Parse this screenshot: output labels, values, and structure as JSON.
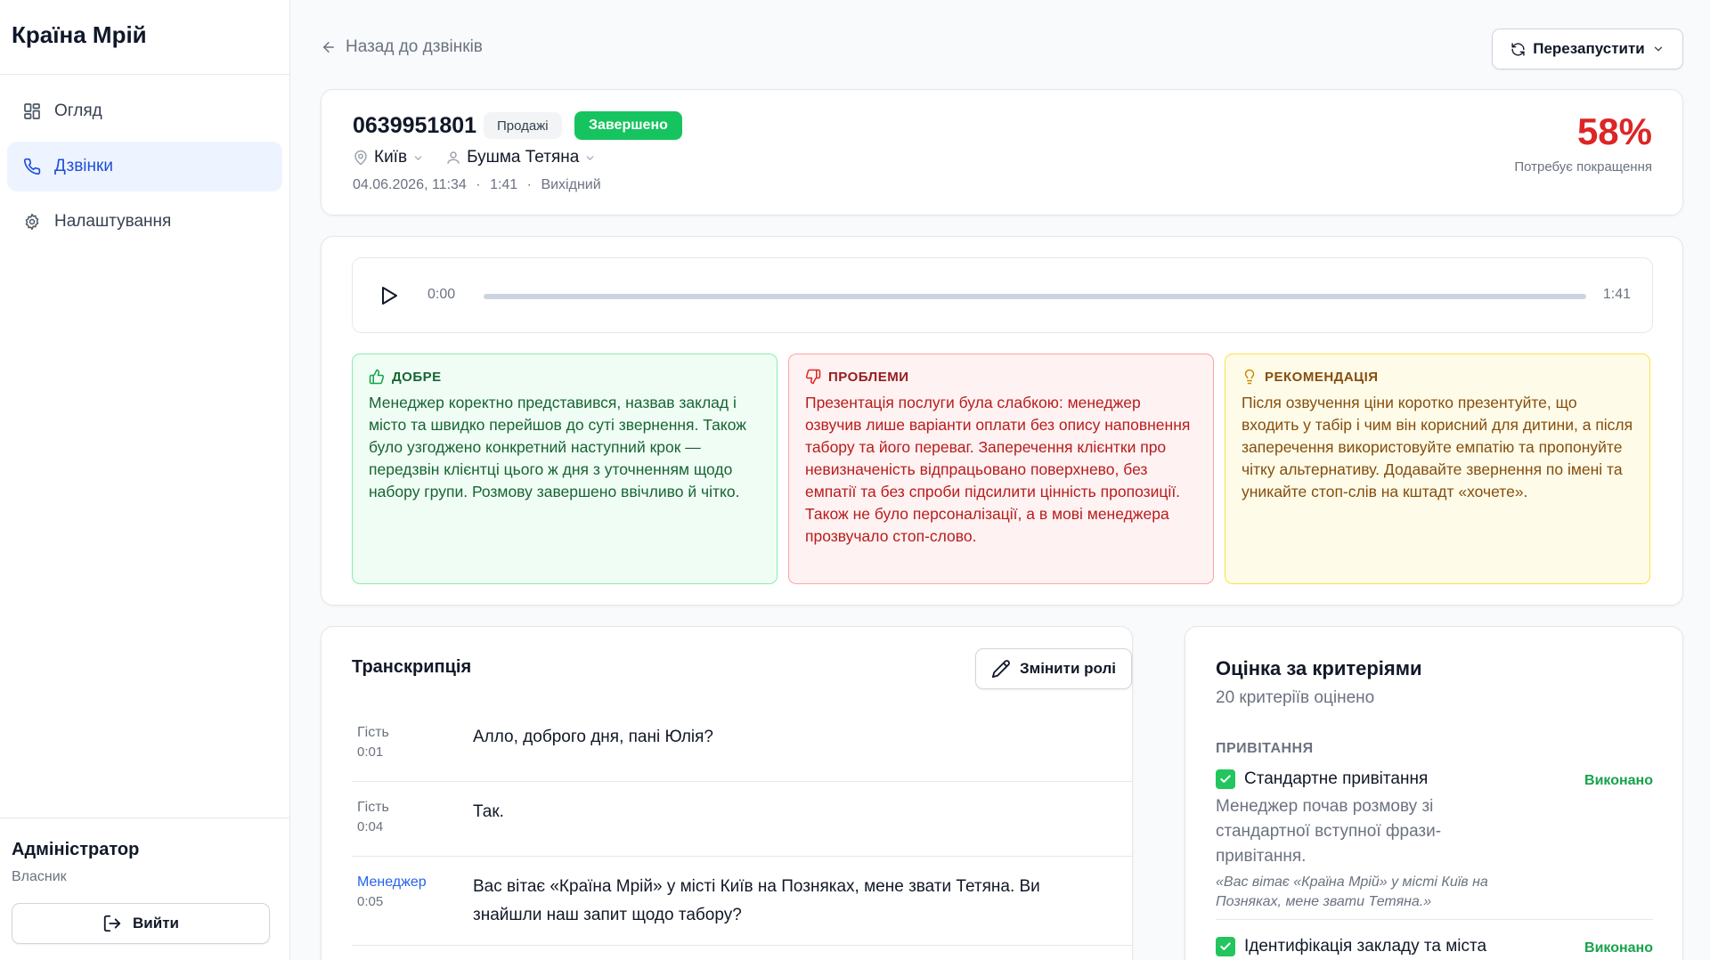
{
  "app": {
    "title": "Країна Мрій"
  },
  "sidebar": {
    "items": [
      {
        "label": "Огляд",
        "icon": "grid-icon",
        "active": false
      },
      {
        "label": "Дзвінки",
        "icon": "phone-icon",
        "active": true
      },
      {
        "label": "Налаштування",
        "icon": "gear-icon",
        "active": false
      }
    ],
    "user": {
      "name": "Адміністратор",
      "role": "Власник"
    },
    "logout_label": "Вийти"
  },
  "topbar": {
    "back_label": "Назад до дзвінків",
    "restart_label": "Перезапустити"
  },
  "call": {
    "phone": "0639951801",
    "category": "Продажі",
    "status": "Завершено",
    "city": "Київ",
    "manager": "Бушма Тетяна",
    "datetime": "04.06.2026, 11:34",
    "duration": "1:41",
    "direction": "Вихідний",
    "separator": "·",
    "score": "58%",
    "score_label": "Потребує покращення"
  },
  "player": {
    "current_time": "0:00",
    "total_time": "1:41",
    "progress": 0
  },
  "feedback": {
    "good": {
      "title": "ДОБРЕ",
      "text": "Менеджер коректно представився, назвав заклад і місто та швидко перейшов до суті звернення. Також було узгоджено конкретний наступний крок — передзвін клієнтці цього ж дня з уточненням щодо набору групи. Розмову завершено ввічливо й чітко."
    },
    "problems": {
      "title": "ПРОБЛЕМИ",
      "text": "Презентація послуги була слабкою: менеджер озвучив лише варіанти оплати без опису наповнення табору та його переваг. Заперечення клієнтки про невизначеність відпрацьовано поверхнево, без емпатії та без спроби підсилити цінність пропозиції. Також не було персоналізації, а в мові менеджера прозвучало стоп-слово."
    },
    "recommendations": {
      "title": "РЕКОМЕНДАЦІЯ",
      "text": "Після озвучення ціни коротко презентуйте, що входить у табір і чим він корисний для дитини, а після заперечення використовуйте емпатію та пропонуйте чітку альтернативу. Додавайте звернення по імені та уникайте стоп-слів на кштадт «хочете»."
    }
  },
  "transcript": {
    "title": "Транскрипція",
    "change_roles_label": "Змінити ролі",
    "rows": [
      {
        "speaker": "Гість",
        "time": "0:01",
        "text": "Алло, доброго дня, пані Юлія?",
        "role": "guest"
      },
      {
        "speaker": "Гість",
        "time": "0:04",
        "text": "Так.",
        "role": "guest"
      },
      {
        "speaker": "Менеджер",
        "time": "0:05",
        "text": "Вас вітає «Країна Мрій» у місті Київ на Позняках, мене звати Тетяна. Ви знайшли наш запит щодо табору?",
        "role": "manager"
      }
    ]
  },
  "criteria": {
    "title": "Оцінка за критеріями",
    "subtitle": "20 критеріїв оцінено",
    "group": "ПРИВІТАННЯ",
    "items": [
      {
        "name": "Стандартне привітання",
        "status": "Виконано",
        "description": "Менеджер почав розмову зі стандартної вступної фрази-привітання.",
        "quote": "«Вас вітає «Країна Мрій» у місті Київ на Позняках, мене звати Тетяна.»"
      },
      {
        "name": "Ідентифікація закладу та міста",
        "status": "Виконано"
      }
    ]
  },
  "colors": {
    "accent": "#1d4ed8",
    "status_done": "#16c45f",
    "score_bad": "#dc2626"
  }
}
